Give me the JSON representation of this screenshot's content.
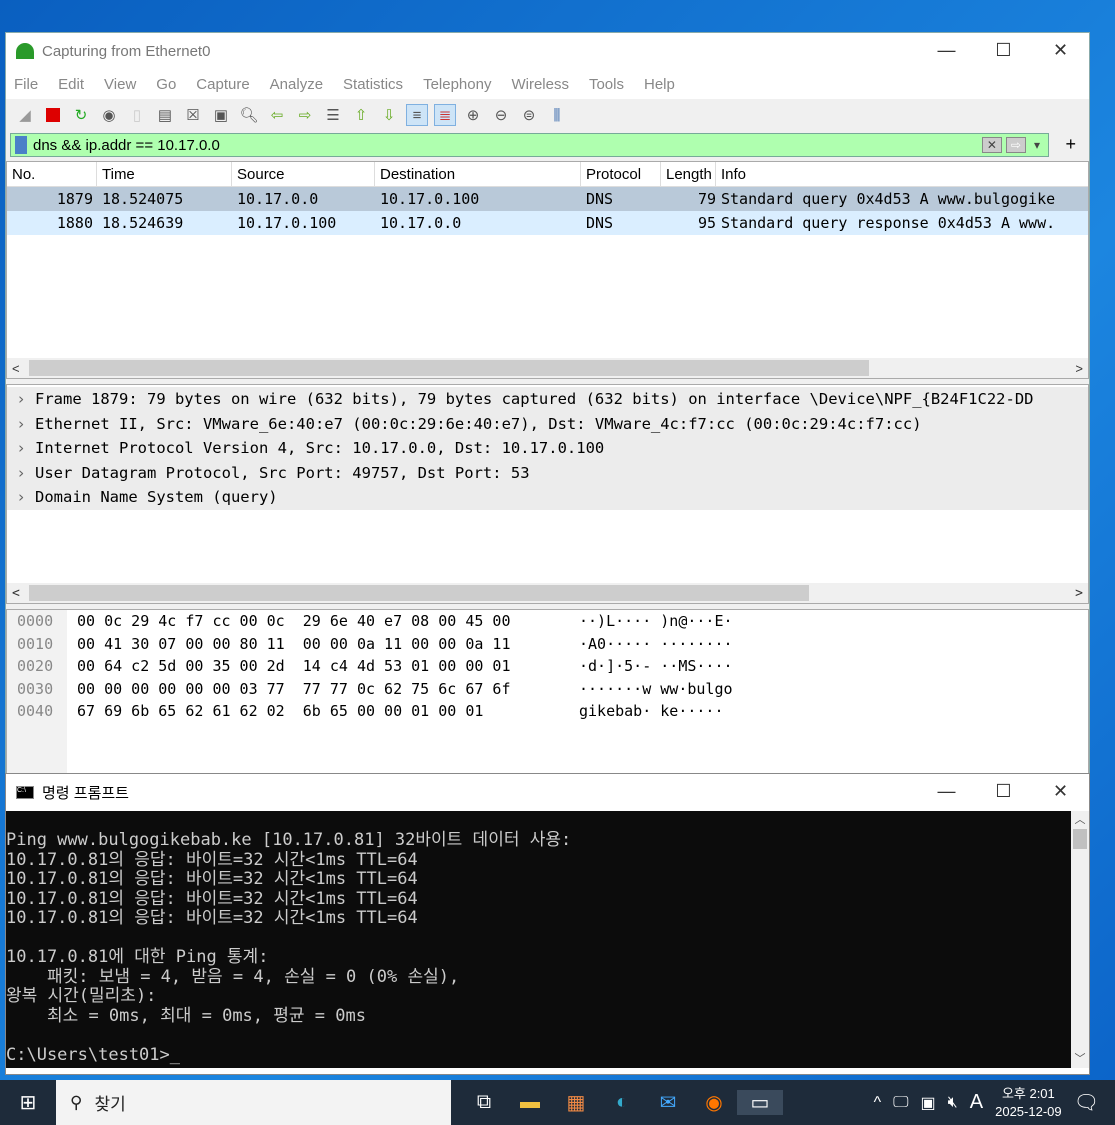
{
  "wireshark": {
    "title": "Capturing from Ethernet0",
    "menu": [
      "File",
      "Edit",
      "View",
      "Go",
      "Capture",
      "Analyze",
      "Statistics",
      "Telephony",
      "Wireless",
      "Tools",
      "Help"
    ],
    "filter": "dns && ip.addr == 10.17.0.0",
    "columns": [
      "No.",
      "Time",
      "Source",
      "Destination",
      "Protocol",
      "Length",
      "Info"
    ],
    "packets": [
      {
        "no": "1879",
        "time": "18.524075",
        "src": "10.17.0.0",
        "dst": "10.17.0.100",
        "proto": "DNS",
        "len": "79",
        "info": "Standard query 0x4d53 A www.bulgogike"
      },
      {
        "no": "1880",
        "time": "18.524639",
        "src": "10.17.0.100",
        "dst": "10.17.0.0",
        "proto": "DNS",
        "len": "95",
        "info": "Standard query response 0x4d53 A www."
      }
    ],
    "details": [
      "Frame 1879: 79 bytes on wire (632 bits), 79 bytes captured (632 bits) on interface \\Device\\NPF_{B24F1C22-DD",
      "Ethernet II, Src: VMware_6e:40:e7 (00:0c:29:6e:40:e7), Dst: VMware_4c:f7:cc (00:0c:29:4c:f7:cc)",
      "Internet Protocol Version 4, Src: 10.17.0.0, Dst: 10.17.0.100",
      "User Datagram Protocol, Src Port: 49757, Dst Port: 53",
      "Domain Name System (query)"
    ],
    "bytes": [
      {
        "off": "0000",
        "hex": "00 0c 29 4c f7 cc 00 0c  29 6e 40 e7 08 00 45 00",
        "ascii": "··)L···· )n@···E·"
      },
      {
        "off": "0010",
        "hex": "00 41 30 07 00 00 80 11  00 00 0a 11 00 00 0a 11",
        "ascii": "·A0····· ········"
      },
      {
        "off": "0020",
        "hex": "00 64 c2 5d 00 35 00 2d  14 c4 4d 53 01 00 00 01",
        "ascii": "·d·]·5·- ··MS····"
      },
      {
        "off": "0030",
        "hex": "00 00 00 00 00 00 03 77  77 77 0c 62 75 6c 67 6f",
        "ascii": "·······w ww·bulgo"
      },
      {
        "off": "0040",
        "hex": "67 69 6b 65 62 61 62 02  6b 65 00 00 01 00 01",
        "ascii": "gikebab· ke·····"
      }
    ]
  },
  "cmd": {
    "title": "명령 프롬프트",
    "lines": [
      "Ping www.bulgogikebab.ke [10.17.0.81] 32바이트 데이터 사용:",
      "10.17.0.81의 응답: 바이트=32 시간<1ms TTL=64",
      "10.17.0.81의 응답: 바이트=32 시간<1ms TTL=64",
      "10.17.0.81의 응답: 바이트=32 시간<1ms TTL=64",
      "10.17.0.81의 응답: 바이트=32 시간<1ms TTL=64",
      "",
      "10.17.0.81에 대한 Ping 통계:",
      "    패킷: 보냄 = 4, 받음 = 4, 손실 = 0 (0% 손실),",
      "왕복 시간(밀리초):",
      "    최소 = 0ms, 최대 = 0ms, 평균 = 0ms",
      "",
      "C:\\Users\\test01>_"
    ]
  },
  "taskbar": {
    "search": "찾기",
    "time": "오후 2:01",
    "date": "2025-12-09",
    "ime": "A"
  }
}
